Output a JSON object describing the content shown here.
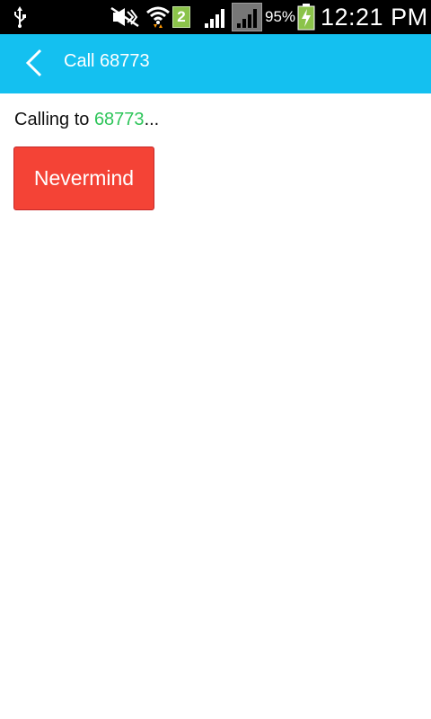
{
  "status_bar": {
    "sim_slot": "2",
    "battery_percent": "95%",
    "time": "12:21 PM",
    "icons": [
      "usb-icon",
      "mute-icon",
      "wifi-icon",
      "sim2-icon",
      "signal-icon",
      "signal-icon",
      "battery-charging-icon"
    ]
  },
  "app_bar": {
    "title": "Call 68773",
    "back_icon": "chevron-left-icon",
    "background": "#14c0f0"
  },
  "content": {
    "calling_prefix": "Calling to ",
    "calling_number": "68773",
    "calling_suffix": "...",
    "number_color": "#2ec55a",
    "nevermind_label": "Nevermind",
    "nevermind_color": "#f44336"
  }
}
